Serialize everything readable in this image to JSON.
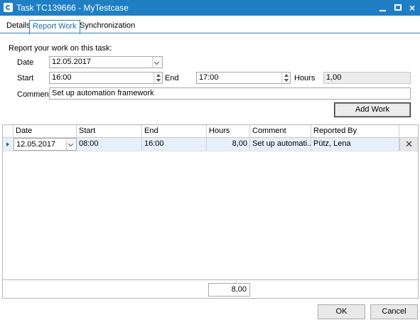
{
  "window": {
    "title": "Task TC139666 - MyTestcase",
    "icon": "app-icon",
    "controls": {
      "minimize": "minimize-icon",
      "maximize": "maximize-icon",
      "close": "×"
    }
  },
  "tabs": [
    {
      "label": "Details",
      "active": false
    },
    {
      "label": "Report Work",
      "active": true
    },
    {
      "label": "Synchronization",
      "active": false
    }
  ],
  "form": {
    "heading": "Report your work on this task:",
    "date_label": "Date",
    "date_value": "12.05.2017",
    "start_label": "Start",
    "start_value": "16:00",
    "end_label": "End",
    "end_value": "17:00",
    "hours_label": "Hours",
    "hours_value": "1,00",
    "comment_label": "Comment",
    "comment_value": "Set up automation framework",
    "add_button": "Add Work"
  },
  "grid": {
    "columns": [
      "Date",
      "Start",
      "End",
      "Hours",
      "Comment",
      "Reported By"
    ],
    "rows": [
      {
        "date": "12.05.2017",
        "start": "08:00",
        "end": "16:00",
        "hours": "8,00",
        "comment": "Set up automati...",
        "reported_by": "Pütz, Lena",
        "delete": "✕"
      }
    ],
    "total_hours": "8,00"
  },
  "footer": {
    "ok": "OK",
    "cancel": "Cancel"
  },
  "colors": {
    "titlebar": "#1e7fc5",
    "accent": "#2a82c8",
    "selected_row": "#e6f0fa"
  }
}
